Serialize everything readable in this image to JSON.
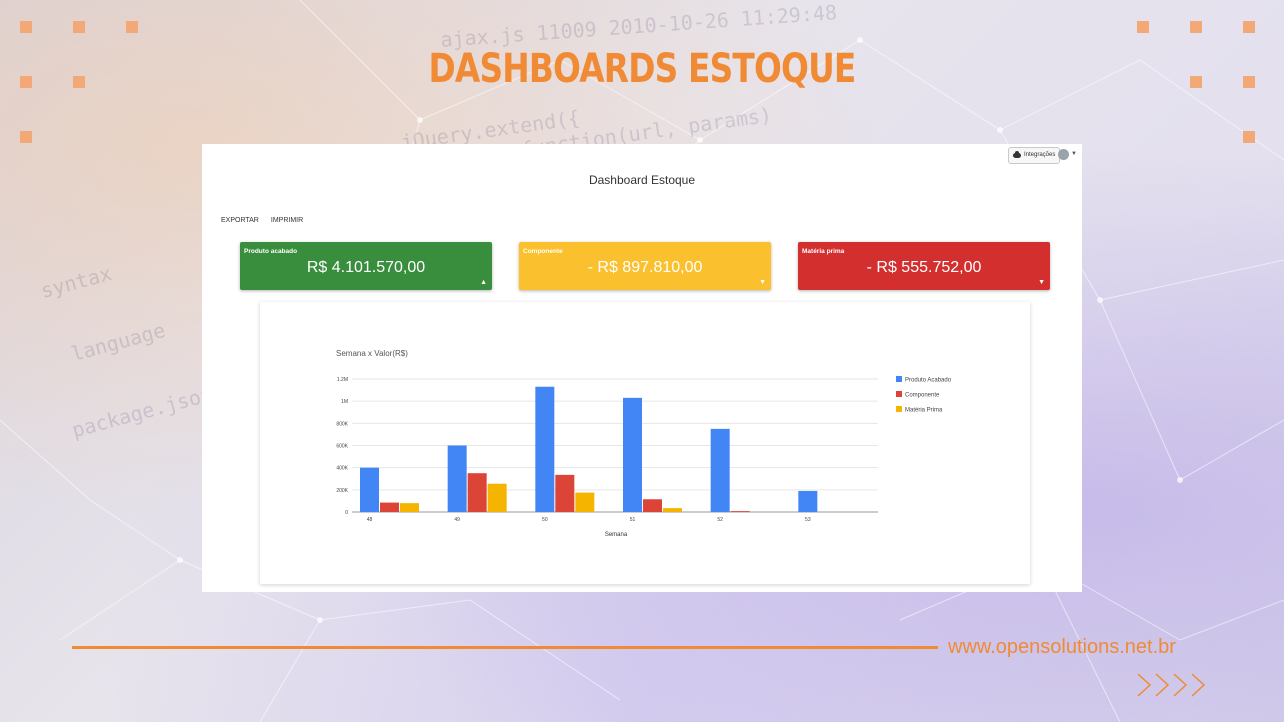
{
  "page": {
    "title": "DASHBOARDS ESTOQUE",
    "url": "www.opensolutions.net.br"
  },
  "background_code": [
    "jQuery.extend({",
    "function(url, params)",
    "ajax.js 11009 2010-10-26 11:29:48",
    "syntax",
    "language",
    "package.json"
  ],
  "app": {
    "integrations_label": "Integrações",
    "dashboard_title": "Dashboard Estoque",
    "toolbar": {
      "export": "EXPORTAR",
      "print": "IMPRIMIR"
    },
    "cards": [
      {
        "label": "Produto acabado",
        "value": "R$ 4.101.570,00",
        "arrow": "▲",
        "color": "#388e3c"
      },
      {
        "label": "Componente",
        "value": "- R$ 897.810,00",
        "arrow": "▼",
        "color": "#fbc02d"
      },
      {
        "label": "Matéria prima",
        "value": "- R$ 555.752,00",
        "arrow": "▼",
        "color": "#d32f2f"
      }
    ]
  },
  "chart_data": {
    "type": "bar",
    "title": "Semana x Valor(R$)",
    "xlabel": "Semana",
    "ylabel": "",
    "categories": [
      "48",
      "49",
      "50",
      "51",
      "52",
      "53"
    ],
    "yticks": [
      "0",
      "200K",
      "400K",
      "600K",
      "800K",
      "1M",
      "1.2M"
    ],
    "ylim": [
      0,
      1200000
    ],
    "grid": true,
    "legend": "right",
    "series": [
      {
        "name": "Produto Acabado",
        "color": "#4285f4",
        "values": [
          400000,
          600000,
          1130000,
          1030000,
          750000,
          190000
        ]
      },
      {
        "name": "Componente",
        "color": "#db4437",
        "values": [
          85000,
          350000,
          335000,
          115000,
          8000,
          0
        ]
      },
      {
        "name": "Matéria Prima",
        "color": "#f4b400",
        "values": [
          80000,
          255000,
          175000,
          35000,
          0,
          0
        ]
      }
    ]
  }
}
